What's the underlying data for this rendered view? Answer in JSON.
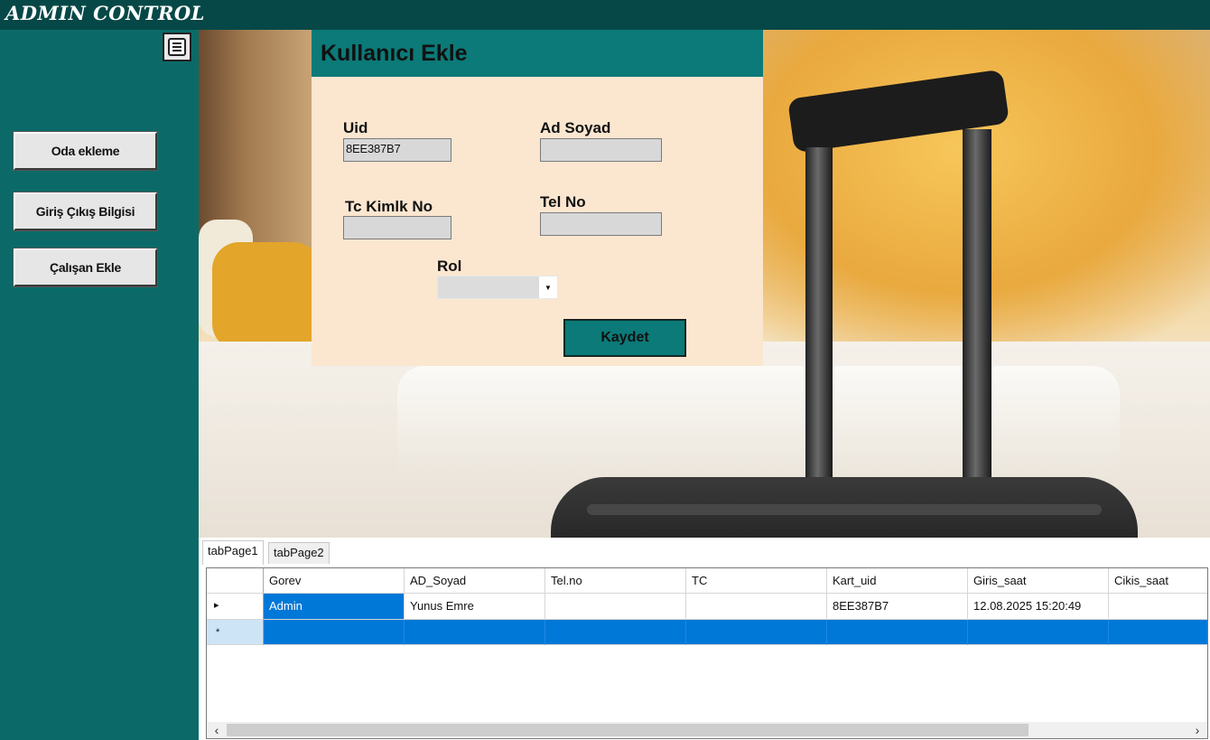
{
  "window": {
    "title": "ADMIN CONTROL"
  },
  "sidebar": {
    "menu_icon": "hamburger-menu-icon",
    "buttons": [
      {
        "label": "Oda ekleme"
      },
      {
        "label": "Giriş Çıkış Bilgisi"
      },
      {
        "label": "Çalışan  Ekle"
      }
    ]
  },
  "form": {
    "title": "Kullanıcı Ekle",
    "uid": {
      "label": "Uid",
      "value": "8EE387B7"
    },
    "ad_soyad": {
      "label": "Ad Soyad",
      "value": ""
    },
    "tc": {
      "label": "Tc Kimlk No",
      "value": ""
    },
    "tel": {
      "label": "Tel No",
      "value": ""
    },
    "rol": {
      "label": "Rol",
      "value": ""
    },
    "save_label": "Kaydet"
  },
  "tabs": [
    {
      "label": "tabPage1"
    },
    {
      "label": "tabPage2"
    }
  ],
  "grid": {
    "columns": [
      "Gorev",
      "AD_Soyad",
      "Tel.no",
      "TC",
      "Kart_uid",
      "Giris_saat",
      "Cikis_saat"
    ],
    "rows": [
      {
        "marker": "▸",
        "cells": [
          "Admin",
          "Yunus Emre",
          "",
          "",
          "8EE387B7",
          "12.08.2025 15:20:49",
          ""
        ]
      }
    ],
    "new_row_marker": "*",
    "selected_color": "#0078d7"
  }
}
